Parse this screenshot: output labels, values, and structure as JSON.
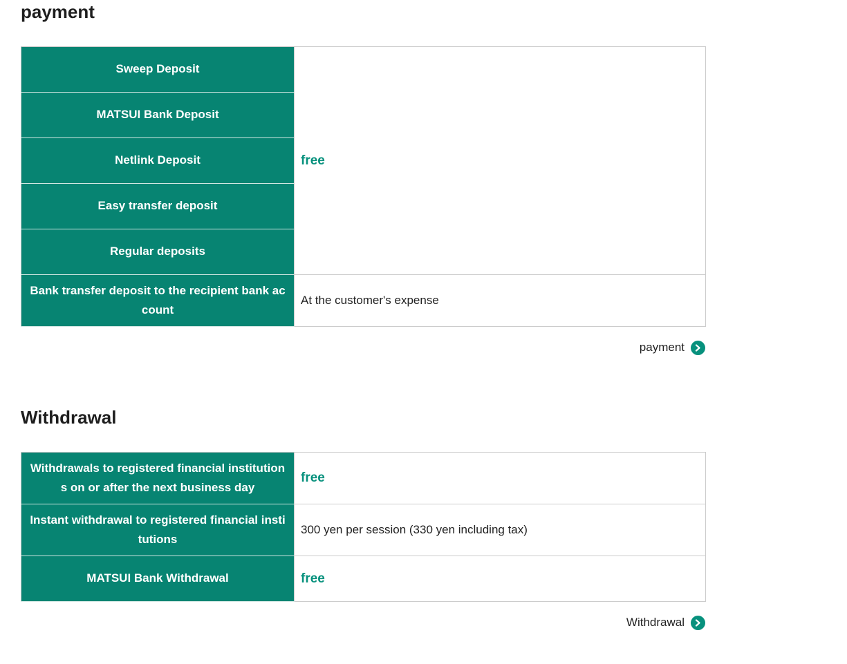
{
  "payment": {
    "title": "payment",
    "rows": [
      {
        "label": "Sweep Deposit"
      },
      {
        "label": "MATSUI Bank Deposit"
      },
      {
        "label": "Netlink Deposit"
      },
      {
        "label": "Easy transfer deposit"
      },
      {
        "label": "Regular deposits"
      },
      {
        "label": "Bank transfer deposit to the recipient bank account"
      }
    ],
    "fee_free": "free",
    "fee_customer": "At the customer's expense",
    "link_label": "payment"
  },
  "withdrawal": {
    "title": "Withdrawal",
    "rows": [
      {
        "label": "Withdrawals to registered financial institutions on or after the next business day",
        "fee": "free"
      },
      {
        "label": "Instant withdrawal to registered financial institutions",
        "fee": "300 yen per session (330 yen including tax)"
      },
      {
        "label": "MATSUI Bank Withdrawal",
        "fee": "free"
      }
    ],
    "link_label": "Withdrawal"
  },
  "colors": {
    "header_bg": "#078472",
    "accent": "#07917d"
  },
  "icons": {
    "more_link": "chevron-right-circle-icon"
  }
}
